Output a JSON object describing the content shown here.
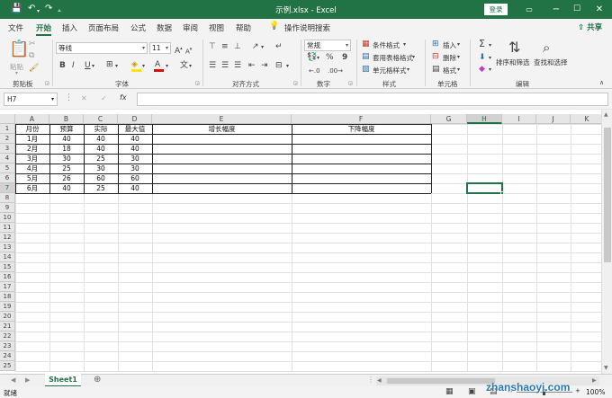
{
  "window": {
    "title": "示例.xlsx - Excel",
    "login": "登录",
    "colors": {
      "accent": "#217346"
    }
  },
  "quick_access": {
    "save": "💾",
    "undo": "↶",
    "redo": "↷",
    "customize": "⩡"
  },
  "tabs": [
    {
      "label": "文件",
      "active": false
    },
    {
      "label": "开始",
      "active": true
    },
    {
      "label": "插入",
      "active": false
    },
    {
      "label": "页面布局",
      "active": false
    },
    {
      "label": "公式",
      "active": false
    },
    {
      "label": "数据",
      "active": false
    },
    {
      "label": "审阅",
      "active": false
    },
    {
      "label": "视图",
      "active": false
    },
    {
      "label": "帮助",
      "active": false
    }
  ],
  "tell_me": "操作说明搜索",
  "share": "共享",
  "ribbon": {
    "clipboard": {
      "label": "剪贴板",
      "paste": "粘贴"
    },
    "font": {
      "label": "字体",
      "name": "等线",
      "size": "11",
      "bold": "B",
      "italic": "I",
      "underline": "U",
      "grow": "A",
      "shrink": "A"
    },
    "alignment": {
      "label": "对齐方式"
    },
    "number": {
      "label": "数字",
      "format": "常规",
      "percent": "%",
      "comma": "9"
    },
    "styles": {
      "label": "样式",
      "conditional": "条件格式",
      "table": "套用表格格式",
      "cell_styles": "单元格样式"
    },
    "cells": {
      "label": "单元格",
      "insert": "插入",
      "delete": "删除",
      "format": "格式"
    },
    "editing": {
      "label": "编辑",
      "sort": "排序和筛选",
      "find": "查找和选择"
    }
  },
  "formula_bar": {
    "name_box": "H7",
    "fx": "fx",
    "cancel": "✕",
    "enter": "✓",
    "formula": ""
  },
  "columns": [
    "A",
    "B",
    "C",
    "D",
    "E",
    "F",
    "G",
    "H",
    "I",
    "J",
    "K"
  ],
  "active_col": "H",
  "active_row": 7,
  "rows": [
    1,
    2,
    3,
    4,
    5,
    6,
    7,
    8,
    9,
    10,
    11,
    12,
    13,
    14,
    15,
    16,
    17,
    18,
    19,
    20,
    21,
    22,
    23,
    24,
    25
  ],
  "table": {
    "headers": [
      "月份",
      "预算",
      "实际",
      "最大值",
      "增长幅度",
      "下降幅度"
    ],
    "data": [
      [
        "1月",
        "40",
        "40",
        "40",
        "",
        ""
      ],
      [
        "2月",
        "18",
        "40",
        "40",
        "",
        ""
      ],
      [
        "3月",
        "30",
        "25",
        "30",
        "",
        ""
      ],
      [
        "4月",
        "25",
        "30",
        "30",
        "",
        ""
      ],
      [
        "5月",
        "26",
        "60",
        "60",
        "",
        ""
      ],
      [
        "6月",
        "40",
        "25",
        "40",
        "",
        ""
      ]
    ]
  },
  "sheets": [
    {
      "name": "Sheet1",
      "active": true
    }
  ],
  "status": {
    "ready": "就绪",
    "zoom": "100%",
    "watermark": "zhanshaoyi.com"
  }
}
